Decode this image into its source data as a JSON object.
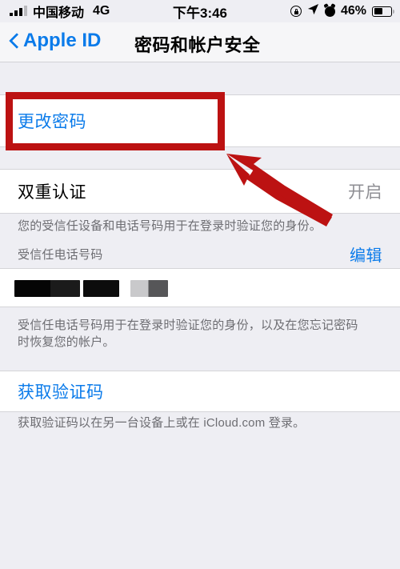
{
  "status_bar": {
    "carrier": "中国移动",
    "network": "4G",
    "time": "下午3:46",
    "battery_percent": "46%",
    "icons": [
      "signal-bars-icon",
      "rotation-lock-icon",
      "location-arrow-icon",
      "alarm-clock-icon",
      "battery-icon"
    ]
  },
  "nav": {
    "back_label": "Apple ID",
    "title": "密码和帐户安全",
    "back_icon": "chevron-left-icon",
    "tint_color": "#0b7bea"
  },
  "sections": {
    "change_password": {
      "label": "更改密码"
    },
    "two_factor": {
      "label": "双重认证",
      "value": "开启",
      "footer": "您的受信任设备和电话号码用于在登录时验证您的身份。"
    },
    "trusted_numbers": {
      "header": "受信任电话号码",
      "edit_label": "编辑",
      "phone_number": "",
      "footer": "受信任电话号码用于在登录时验证您的身份，以及在您忘记密码时恢复您的帐户。"
    },
    "verification_code": {
      "label": "获取验证码",
      "footer": "获取验证码以在另一台设备上或在 iCloud.com 登录。"
    }
  },
  "annotations": {
    "highlight_color": "#bc1212",
    "box_target": "更改密码",
    "arrow_points_to": "更改密码"
  }
}
